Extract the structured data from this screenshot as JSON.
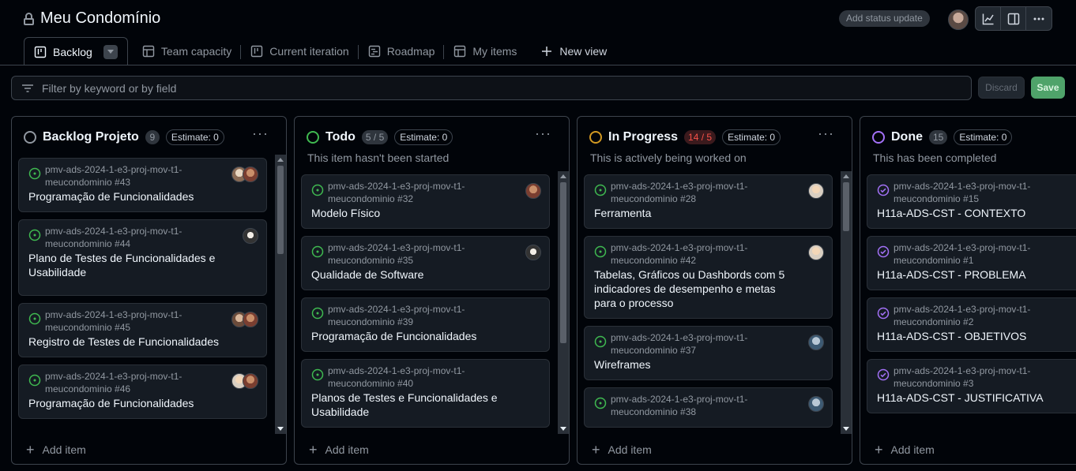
{
  "header": {
    "title": "Meu Condomínio",
    "status_update_label": "Add status update"
  },
  "tabs": [
    {
      "label": "Backlog",
      "icon": "board-icon"
    },
    {
      "label": "Team capacity",
      "icon": "table-icon"
    },
    {
      "label": "Current iteration",
      "icon": "board-icon"
    },
    {
      "label": "Roadmap",
      "icon": "roadmap-icon"
    },
    {
      "label": "My items",
      "icon": "table-icon"
    }
  ],
  "new_view_label": "New view",
  "filter": {
    "placeholder": "Filter by keyword or by field"
  },
  "actions": {
    "discard": "Discard",
    "save": "Save"
  },
  "add_item_label": "Add item",
  "colors": {
    "todo": "#3fb950",
    "in_progress": "#d29922",
    "done": "#a371f7",
    "backlog": "#9198a1",
    "save": "#4fa36a"
  },
  "columns": [
    {
      "name": "Backlog Projeto",
      "count": "9",
      "estimate": "Estimate: 0",
      "description": "",
      "cards": [
        {
          "repo": "pmv-ads-2024-1-e3-proj-mov-t1-",
          "ref": "meucondominio #43",
          "title": "Programação de Funcionalidades"
        },
        {
          "repo": "pmv-ads-2024-1-e3-proj-mov-t1-",
          "ref": "meucondominio #44",
          "title": "Plano de Testes de Funcionalidades e Usabilidade"
        },
        {
          "repo": "pmv-ads-2024-1-e3-proj-mov-t1-",
          "ref": "meucondominio #45",
          "title": "Registro de Testes de Funcionalidades"
        },
        {
          "repo": "pmv-ads-2024-1-e3-proj-mov-t1-",
          "ref": "meucondominio #46",
          "title": "Programação de Funcionalidades"
        }
      ]
    },
    {
      "name": "Todo",
      "count": "5 / 5",
      "estimate": "Estimate: 0",
      "description": "This item hasn't been started",
      "cards": [
        {
          "repo": "pmv-ads-2024-1-e3-proj-mov-t1-",
          "ref": "meucondominio #32",
          "title": "Modelo Físico"
        },
        {
          "repo": "pmv-ads-2024-1-e3-proj-mov-t1-",
          "ref": "meucondominio #35",
          "title": "Qualidade de Software"
        },
        {
          "repo": "pmv-ads-2024-1-e3-proj-mov-t1-",
          "ref": "meucondominio #39",
          "title": "Programação de Funcionalidades"
        },
        {
          "repo": "pmv-ads-2024-1-e3-proj-mov-t1-",
          "ref": "meucondominio #40",
          "title": "Planos de Testes e Funcionalidades e Usabilidade"
        }
      ]
    },
    {
      "name": "In Progress",
      "count": "14 / 5",
      "estimate": "Estimate: 0",
      "description": "This is actively being worked on",
      "cards": [
        {
          "repo": "pmv-ads-2024-1-e3-proj-mov-t1-",
          "ref": "meucondominio #28",
          "title": "Ferramenta"
        },
        {
          "repo": "pmv-ads-2024-1-e3-proj-mov-t1-",
          "ref": "meucondominio #42",
          "title": "Tabelas, Gráficos ou Dashbords com 5 indicadores de desempenho e metas para o processo"
        },
        {
          "repo": "pmv-ads-2024-1-e3-proj-mov-t1-",
          "ref": "meucondominio #37",
          "title": "Wireframes"
        },
        {
          "repo": "pmv-ads-2024-1-e3-proj-mov-t1-",
          "ref": "meucondominio #38",
          "title": ""
        }
      ]
    },
    {
      "name": "Done",
      "count": "15",
      "estimate": "Estimate: 0",
      "description": "This has been completed",
      "cards": [
        {
          "repo": "pmv-ads-2024-1-e3-proj-mov-t1-",
          "ref": "meucondominio #15",
          "title": "H11a-ADS-CST - CONTEXTO"
        },
        {
          "repo": "pmv-ads-2024-1-e3-proj-mov-t1-",
          "ref": "meucondominio #1",
          "title": "H11a-ADS-CST - PROBLEMA"
        },
        {
          "repo": "pmv-ads-2024-1-e3-proj-mov-t1-",
          "ref": "meucondominio #2",
          "title": "H11a-ADS-CST - OBJETIVOS"
        },
        {
          "repo": "pmv-ads-2024-1-e3-proj-mov-t1-",
          "ref": "meucondominio #3",
          "title": "H11a-ADS-CST - JUSTIFICATIVA"
        }
      ]
    }
  ]
}
